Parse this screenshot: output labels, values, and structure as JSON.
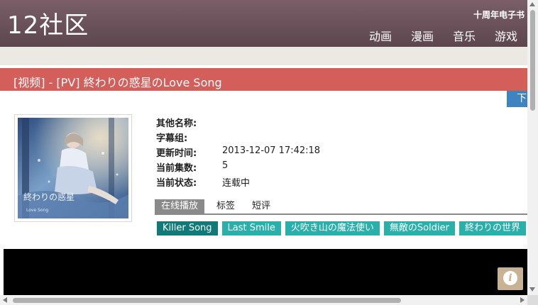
{
  "header": {
    "logo": "12社区",
    "ebook_link": "十周年电子书",
    "nav": [
      "动画",
      "漫画",
      "音乐",
      "游戏"
    ]
  },
  "title_bar": {
    "title": "[视频] - [PV] 終わりの惑星のLove Song"
  },
  "download_button": {
    "label": "下"
  },
  "info": {
    "rows": [
      {
        "label": "其他名称:",
        "value": ""
      },
      {
        "label": "字幕组:",
        "value": ""
      },
      {
        "label": "更新时间:",
        "value": "2013-12-07 17:42:18"
      },
      {
        "label": "当前集数:",
        "value": "5"
      },
      {
        "label": "当前状态:",
        "value": "连载中"
      }
    ]
  },
  "tabs": [
    "在线播放",
    "标签",
    "短评"
  ],
  "episodes": [
    "Killer Song",
    "Last Smile",
    "火吹き山の魔法使い",
    "無敵のSoldier",
    "終わりの世界"
  ],
  "player": {
    "info_icon": "i"
  },
  "colors": {
    "header": "#6b535a",
    "title_bar": "#d35e5a",
    "episode": "#29b0aa",
    "episode_active": "#0f7a78",
    "download": "#3d84c1"
  },
  "icons": [
    "info-icon",
    "cover-image"
  ]
}
